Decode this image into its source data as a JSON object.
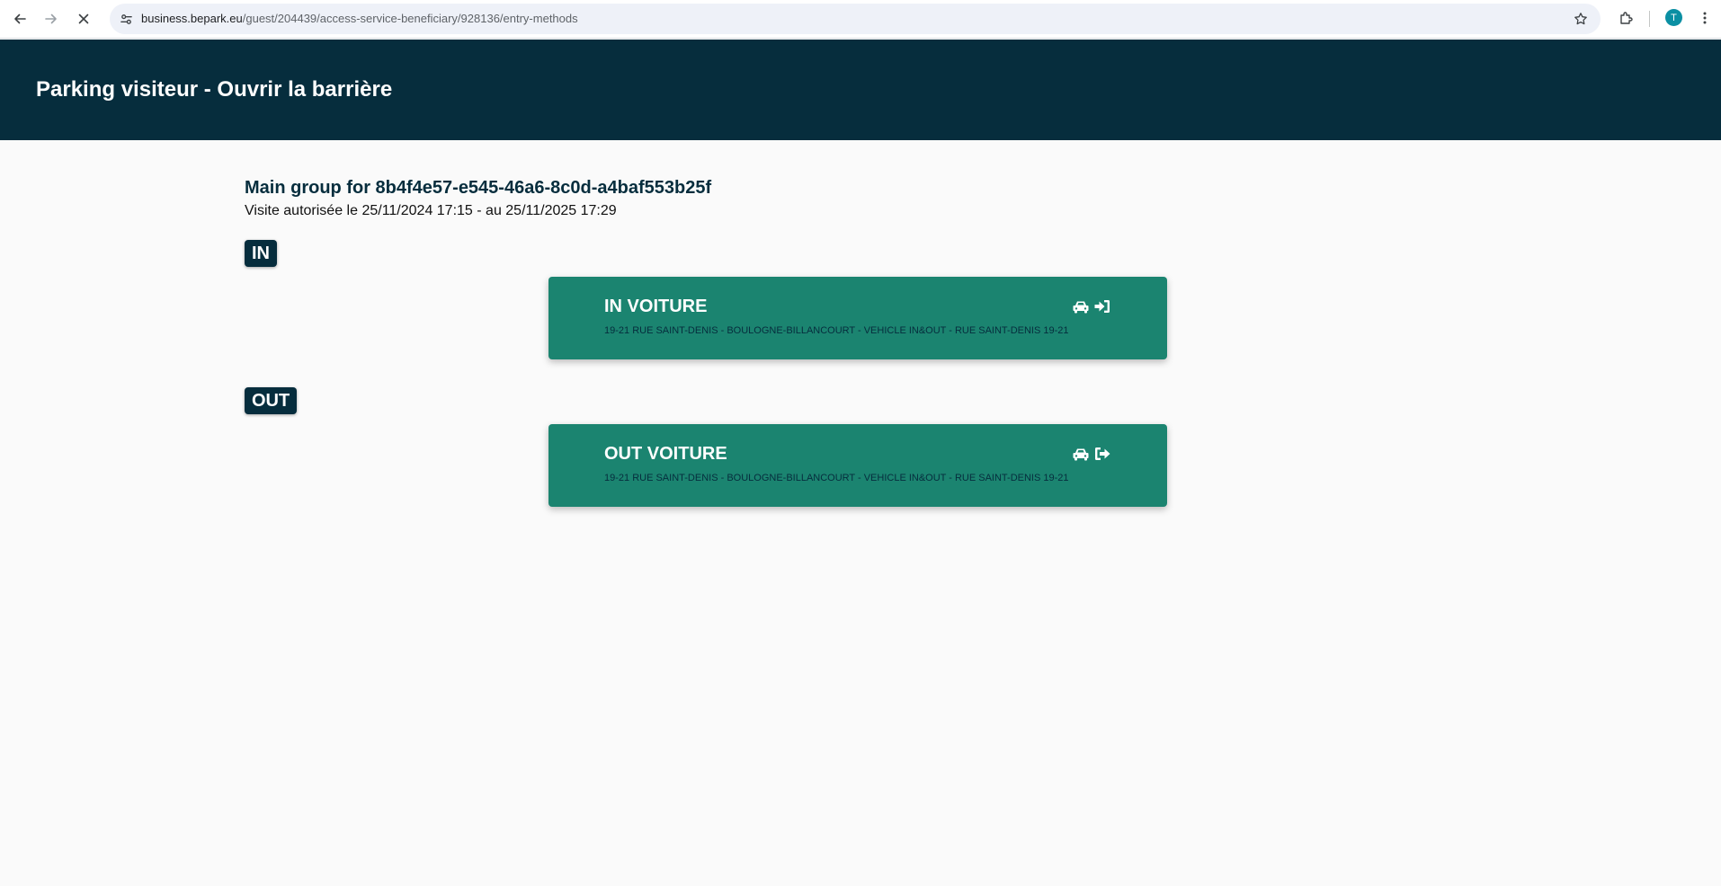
{
  "browser": {
    "url_host": "business.bepark.eu",
    "url_path": "/guest/204439/access-service-beneficiary/928136/entry-methods",
    "profile_initial": "T"
  },
  "header": {
    "title": "Parking visiteur - Ouvrir la barrière"
  },
  "main": {
    "group_title": "Main group for 8b4f4e57-e545-46a6-8c0d-a4baf553b25f",
    "visit_period": "Visite autorisée le 25/11/2024 17:15 - au 25/11/2025 17:29",
    "sections": [
      {
        "badge": "IN",
        "card": {
          "title": "IN VOITURE",
          "address": "19-21 RUE SAINT-DENIS - BOULOGNE-BILLANCOURT - VEHICLE IN&OUT - RUE SAINT-DENIS 19-21",
          "icons": [
            "car-icon",
            "sign-in-icon"
          ]
        }
      },
      {
        "badge": "OUT",
        "card": {
          "title": "OUT VOITURE",
          "address": "19-21 RUE SAINT-DENIS - BOULOGNE-BILLANCOURT - VEHICLE IN&OUT - RUE SAINT-DENIS 19-21",
          "icons": [
            "car-icon",
            "sign-out-icon"
          ]
        }
      }
    ]
  },
  "colors": {
    "header_bg": "#062d3d",
    "card_bg": "#1b8470",
    "page_bg": "#fafafa"
  }
}
